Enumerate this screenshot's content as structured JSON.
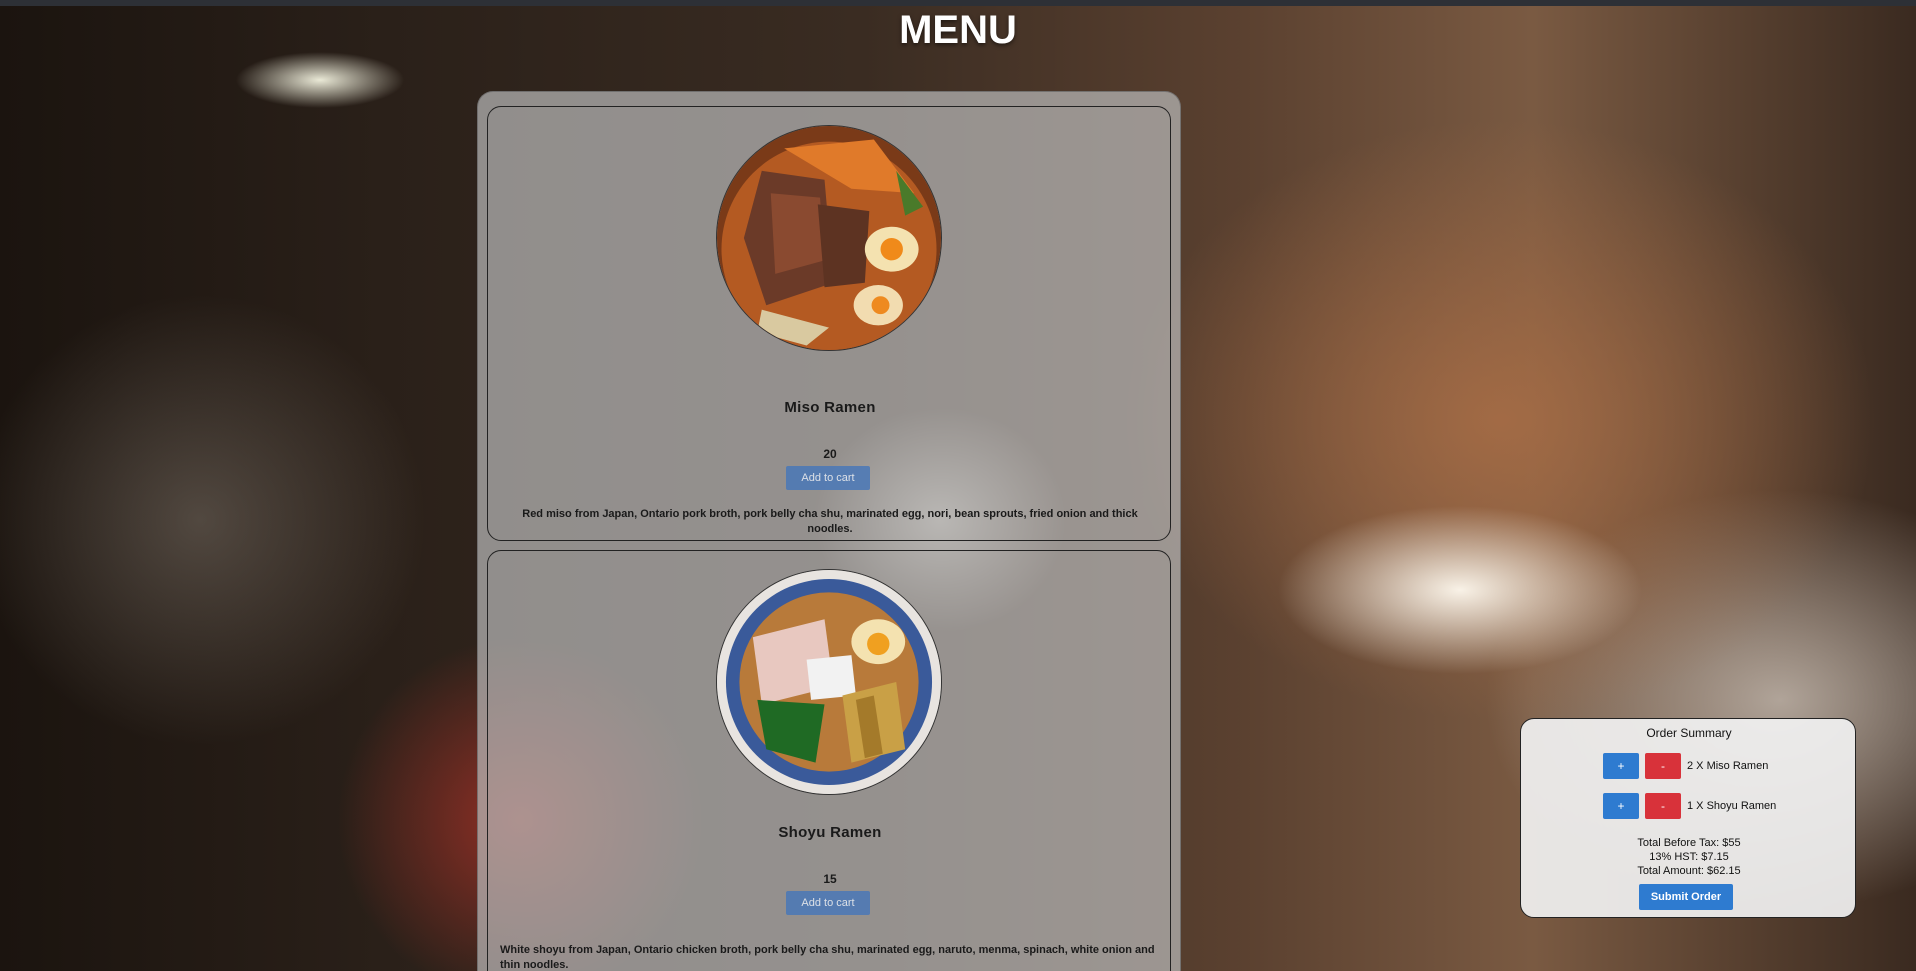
{
  "page": {
    "title": "MENU"
  },
  "menu": {
    "items": [
      {
        "name": "Miso Ramen",
        "price": "20",
        "add_label": "Add to cart",
        "description": "Red miso from Japan, Ontario pork broth, pork belly cha shu, marinated egg, nori, bean sprouts, fried onion and thick noodles."
      },
      {
        "name": "Shoyu Ramen",
        "price": "15",
        "add_label": "Add to cart",
        "description": "White shoyu from Japan, Ontario chicken broth, pork belly cha shu, marinated egg, naruto, menma, spinach, white onion and thin noodles."
      }
    ]
  },
  "summary": {
    "title": "Order Summary",
    "rows": [
      {
        "plus": "+",
        "minus": "-",
        "label": "2 X Miso Ramen"
      },
      {
        "plus": "+",
        "minus": "-",
        "label": "1 X Shoyu Ramen"
      }
    ],
    "total_before_tax": "Total Before Tax: $55",
    "hst": "13% HST: $7.15",
    "total_amount": "Total Amount: $62.15",
    "submit_label": "Submit Order"
  },
  "colors": {
    "primary_button": "#2e7bd0",
    "danger_button": "#d8323a",
    "title_text": "#ffffff"
  }
}
